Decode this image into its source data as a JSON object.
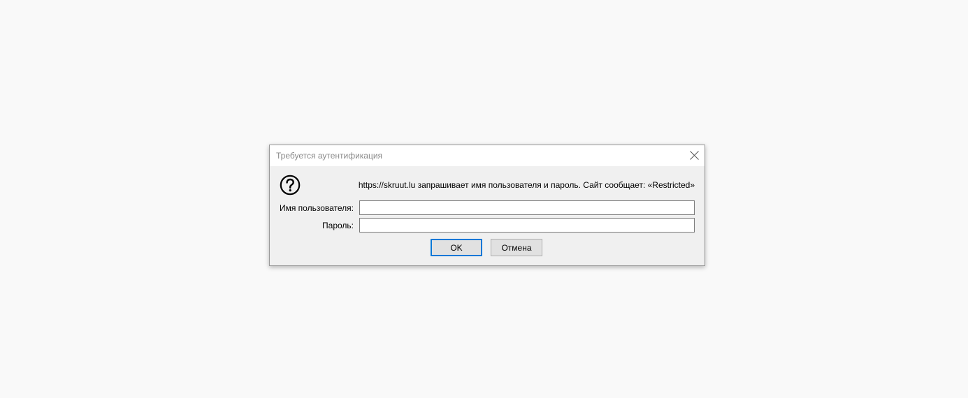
{
  "dialog": {
    "title": "Требуется аутентификация",
    "close_icon": "close-icon",
    "prompt_icon": "question-icon",
    "message": "https://skruut.lu запрашивает имя пользователя и пароль. Сайт сообщает: «Restricted»",
    "username": {
      "label": "Имя пользователя:",
      "value": ""
    },
    "password": {
      "label": "Пароль:",
      "value": ""
    },
    "ok_label": "OK",
    "cancel_label": "Отмена",
    "accent_color": "#0078d7"
  }
}
